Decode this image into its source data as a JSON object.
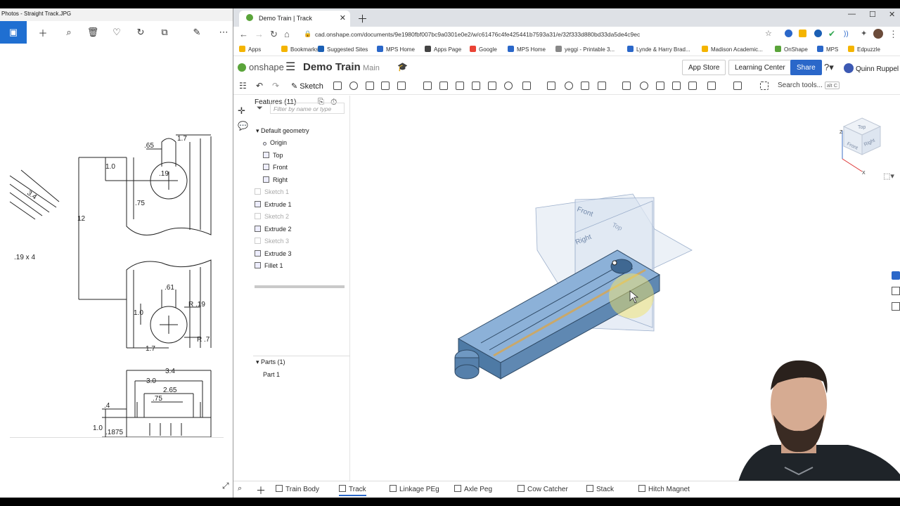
{
  "photos": {
    "title": "Photos - Straight Track.JPG",
    "toolbar": [
      "image-icon",
      "plus-icon",
      "zoom-icon",
      "trash-icon",
      "heart-icon",
      "rotate-icon",
      "crop-icon",
      "edit-icon",
      "more-icon"
    ],
    "drawing_labels": {
      "d65": ".65",
      "d17a": "1.7",
      "d10a": "1.0",
      "d19": ".19",
      "d75a": ".75",
      "d12": "12",
      "d19x4": ".19 x 4",
      "d34a": "3.4",
      "d61": ".61",
      "r19": "R .19",
      "d10b": "1.0",
      "r7": "R .7",
      "d17b": "1.7",
      "d34b": "3.4",
      "d30": "3.0",
      "d265": "2.65",
      "d75b": ".75",
      "d4": ".4",
      "d10c": "1.0",
      "d1875": ".1875"
    }
  },
  "browser": {
    "tab_title": "Demo Train | Track",
    "url": "cad.onshape.com/documents/9e1980fbf007bc9a0301e0e2/w/c61476c4fe425441b7593a31/e/32f333d880bd33da5de4c9ec",
    "bookmarks": [
      {
        "label": "Apps",
        "color": "#f4b400"
      },
      {
        "label": "Bookmarks",
        "color": "#f4b400"
      },
      {
        "label": "Suggested Sites",
        "color": "#1a5fb4"
      },
      {
        "label": "MPS Home",
        "color": "#2a67c9"
      },
      {
        "label": "Apps Page",
        "color": "#444444"
      },
      {
        "label": "Google",
        "color": "#ea4335"
      },
      {
        "label": "MPS Home",
        "color": "#2a67c9"
      },
      {
        "label": "yeggi - Printable 3...",
        "color": "#888888"
      },
      {
        "label": "Lynde & Harry Brad...",
        "color": "#2a67c9"
      },
      {
        "label": "Madison Academic...",
        "color": "#f4b400"
      },
      {
        "label": "OnShape",
        "color": "#5aa43a"
      },
      {
        "label": "MPS",
        "color": "#2a67c9"
      },
      {
        "label": "Edpuzzle",
        "color": "#f4b400"
      }
    ]
  },
  "onshape": {
    "logo": "onshape",
    "doc_title": "Demo Train",
    "branch": "Main",
    "app_store": "App Store",
    "learning_center": "Learning Center",
    "share": "Share",
    "user": "Quinn Ruppel",
    "sketch": "Sketch",
    "search_tools": "Search tools...",
    "search_shortcut": "alt C",
    "features_header": "Features (11)",
    "filter_placeholder": "Filter by name or type",
    "default_geometry": "Default geometry",
    "features": [
      {
        "label": "Origin",
        "dim": false
      },
      {
        "label": "Top",
        "dim": false
      },
      {
        "label": "Front",
        "dim": false
      },
      {
        "label": "Right",
        "dim": false
      },
      {
        "label": "Sketch 1",
        "dim": true
      },
      {
        "label": "Extrude 1",
        "dim": false
      },
      {
        "label": "Sketch 2",
        "dim": true
      },
      {
        "label": "Extrude 2",
        "dim": false
      },
      {
        "label": "Sketch 3",
        "dim": true
      },
      {
        "label": "Extrude 3",
        "dim": false
      },
      {
        "label": "Fillet 1",
        "dim": false
      }
    ],
    "parts_header": "Parts (1)",
    "parts": [
      "Part 1"
    ],
    "plane_labels": {
      "front": "Front",
      "top": "Top",
      "right": "Right"
    },
    "viewcube": {
      "top": "Top",
      "front": "Front",
      "right": "Right",
      "z": "Z",
      "x": "X"
    },
    "tabs": [
      "Train Body",
      "Track",
      "Linkage PEg",
      "Axle Peg",
      "Cow Catcher",
      "Stack",
      "Hitch Magnet"
    ],
    "active_tab": "Track",
    "part_color": "#6d9dcb"
  }
}
